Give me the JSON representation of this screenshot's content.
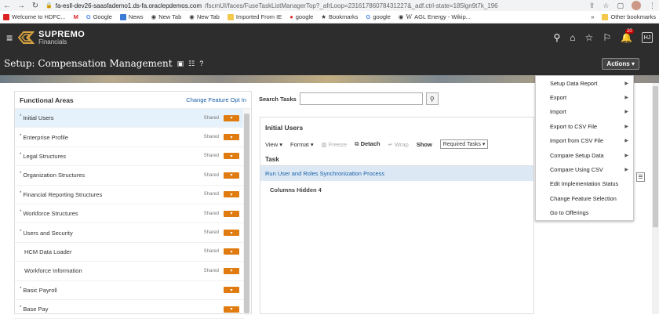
{
  "browser": {
    "url_host": "fa-esll-dev26-saasfademo1.ds-fa.oraclepdemos.com",
    "url_path": "/fscmUI/faces/FuseTaskListManagerTop?_afrLoop=23161786078431227&_adf.ctrl-state=185lgn9t7k_196",
    "bookmarks": [
      "Welcome to HDFC...",
      "Google",
      "News",
      "New Tab",
      "New Tab",
      "Imported From IE",
      "google",
      "Bookmarks",
      "google",
      "AGL Energy - Wikip..."
    ],
    "more": "»",
    "other_bookmarks": "Other bookmarks"
  },
  "header": {
    "logo_line1": "SUPREMO",
    "logo_line2": "Financials",
    "notif_count": "20",
    "user_initials": "HJ"
  },
  "title_bar": {
    "title": "Setup: Compensation Management",
    "actions_label": "Actions ▾"
  },
  "left": {
    "heading": "Functional Areas",
    "change_link": "Change Feature Opt In",
    "items": [
      {
        "label": "Initial Users",
        "shared": "Shared",
        "star": "*"
      },
      {
        "label": "Enterprise Profile",
        "shared": "Shared",
        "star": "*"
      },
      {
        "label": "Legal Structures",
        "shared": "Shared",
        "star": "*"
      },
      {
        "label": "Organization Structures",
        "shared": "Shared",
        "star": "*"
      },
      {
        "label": "Financial Reporting Structures",
        "shared": "Shared",
        "star": "*"
      },
      {
        "label": "Workforce Structures",
        "shared": "Shared",
        "star": "*"
      },
      {
        "label": "Users and Security",
        "shared": "Shared",
        "star": "*"
      },
      {
        "label": "HCM Data Loader",
        "shared": "Shared",
        "star": ""
      },
      {
        "label": "Workforce Information",
        "shared": "Shared",
        "star": ""
      },
      {
        "label": "Basic Payroll",
        "shared": "",
        "star": "*"
      },
      {
        "label": "Base Pay",
        "shared": "",
        "star": "*"
      }
    ]
  },
  "search": {
    "label": "Search Tasks",
    "value": ""
  },
  "tasks": {
    "title": "Initial Users",
    "view": "View ▾",
    "format": "Format ▾",
    "freeze": "Freeze",
    "detach": "Detach",
    "wrap": "Wrap",
    "show": "Show",
    "show_value": "Required Tasks ▾",
    "col_task": "Task",
    "row1": "Run User and Roles Synchronization Process",
    "cols_hidden": "Columns Hidden  4"
  },
  "menu": {
    "items": [
      {
        "label": "Setup Data Report",
        "sub": true
      },
      {
        "label": "Export",
        "sub": true
      },
      {
        "label": "Import",
        "sub": true
      },
      {
        "label": "Export to CSV File",
        "sub": true
      },
      {
        "label": "Import from CSV File",
        "sub": true
      },
      {
        "label": "Compare Setup Data",
        "sub": true
      },
      {
        "label": "Compare Using CSV",
        "sub": true
      },
      {
        "label": "Edit Implementation Status",
        "sub": false
      },
      {
        "label": "Change Feature Selection",
        "sub": false
      },
      {
        "label": "Go to Offerings",
        "sub": false
      }
    ]
  },
  "colors": {
    "header_bg": "#2d2d2d",
    "accent_orange": "#e07b10",
    "link_blue": "#1a5fa8",
    "selected_row": "#e5f1fb"
  }
}
